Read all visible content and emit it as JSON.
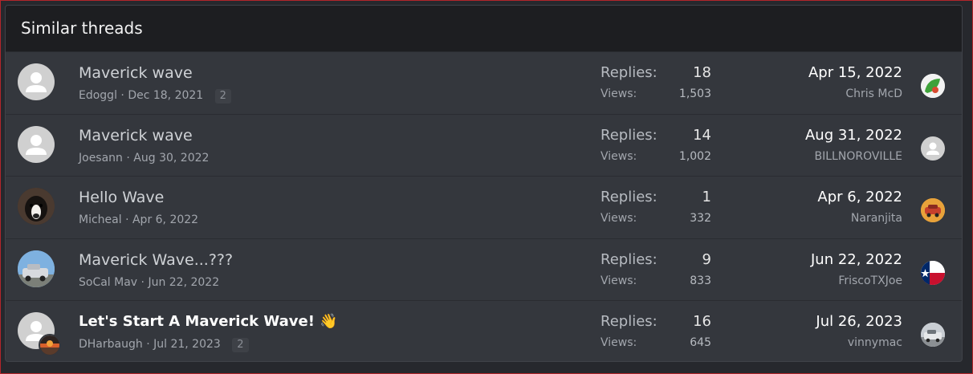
{
  "header": {
    "title": "Similar threads"
  },
  "labels": {
    "replies": "Replies:",
    "views": "Views:"
  },
  "threads": [
    {
      "title": "Maverick wave",
      "author": "Edoggl",
      "date": "Dec 18, 2021",
      "pages": "2",
      "replies": "18",
      "views": "1,503",
      "last_date": "Apr 15, 2022",
      "last_user": "Chris McD",
      "avatar_icon": "default-user-icon",
      "last_avatar_icon": "green-leaf-avatar"
    },
    {
      "title": "Maverick wave",
      "author": "Joesann",
      "date": "Aug 30, 2022",
      "pages": "",
      "replies": "14",
      "views": "1,002",
      "last_date": "Aug 31, 2022",
      "last_user": "BILLNOROVILLE",
      "avatar_icon": "default-user-icon",
      "last_avatar_icon": "default-user-icon"
    },
    {
      "title": "Hello Wave",
      "author": "Micheal",
      "date": "Apr 6, 2022",
      "pages": "",
      "replies": "1",
      "views": "332",
      "last_date": "Apr 6, 2022",
      "last_user": "Naranjita",
      "avatar_icon": "dog-photo-avatar",
      "last_avatar_icon": "orange-car-avatar"
    },
    {
      "title": "Maverick Wave...???",
      "author": "SoCal Mav",
      "date": "Jun 22, 2022",
      "pages": "",
      "replies": "9",
      "views": "833",
      "last_date": "Jun 22, 2022",
      "last_user": "FriscoTXJoe",
      "avatar_icon": "truck-photo-avatar",
      "last_avatar_icon": "texas-flag-avatar"
    },
    {
      "title": "Let's Start A Maverick Wave! 👋",
      "author": "DHarbaugh",
      "date": "Jul 21, 2023",
      "pages": "2",
      "replies": "16",
      "views": "645",
      "last_date": "Jul 26, 2023",
      "last_user": "vinnymac",
      "avatar_icon": "default-user-icon",
      "last_avatar_icon": "truck-photo-avatar"
    }
  ]
}
